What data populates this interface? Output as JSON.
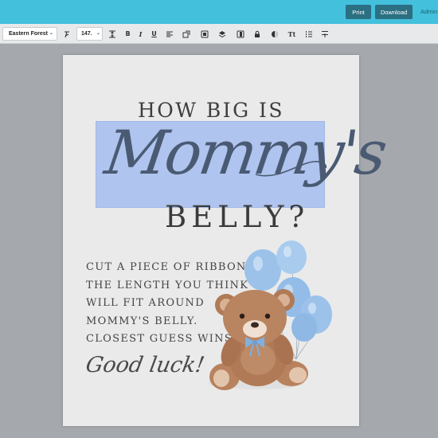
{
  "header": {
    "print_label": "Print",
    "download_label": "Download",
    "admin_label": "Admin"
  },
  "toolbar": {
    "font_family_value": "Eastern Forest",
    "font_size_value": "147.",
    "icons": [
      "format-clear-icon",
      "line-height-icon",
      "bold-icon",
      "italic-icon",
      "underline-icon",
      "align-icon",
      "effects-icon",
      "copy-icon",
      "layers-icon",
      "duplicate-icon",
      "lock-icon",
      "color-fill-icon",
      "text-transform-icon",
      "list-icon",
      "letter-spacing-icon"
    ]
  },
  "canvas": {
    "headline_top": "HOW BIG IS",
    "headline_script": "Mommy's",
    "headline_bottom": "BELLY?",
    "instructions": [
      "CUT A PIECE OF RIBBON TO",
      "THE LENGTH YOU THINK",
      "WILL FIT AROUND",
      "MOMMY'S BELLY.",
      "CLOSEST GUESS WINS!"
    ],
    "closing": "Good luck!"
  },
  "colors": {
    "topbar": "#43c0dc",
    "button": "#2b6f82",
    "selection": "#a9c0ef",
    "balloon": "#9cc2ea",
    "bear": "#b07a57"
  }
}
